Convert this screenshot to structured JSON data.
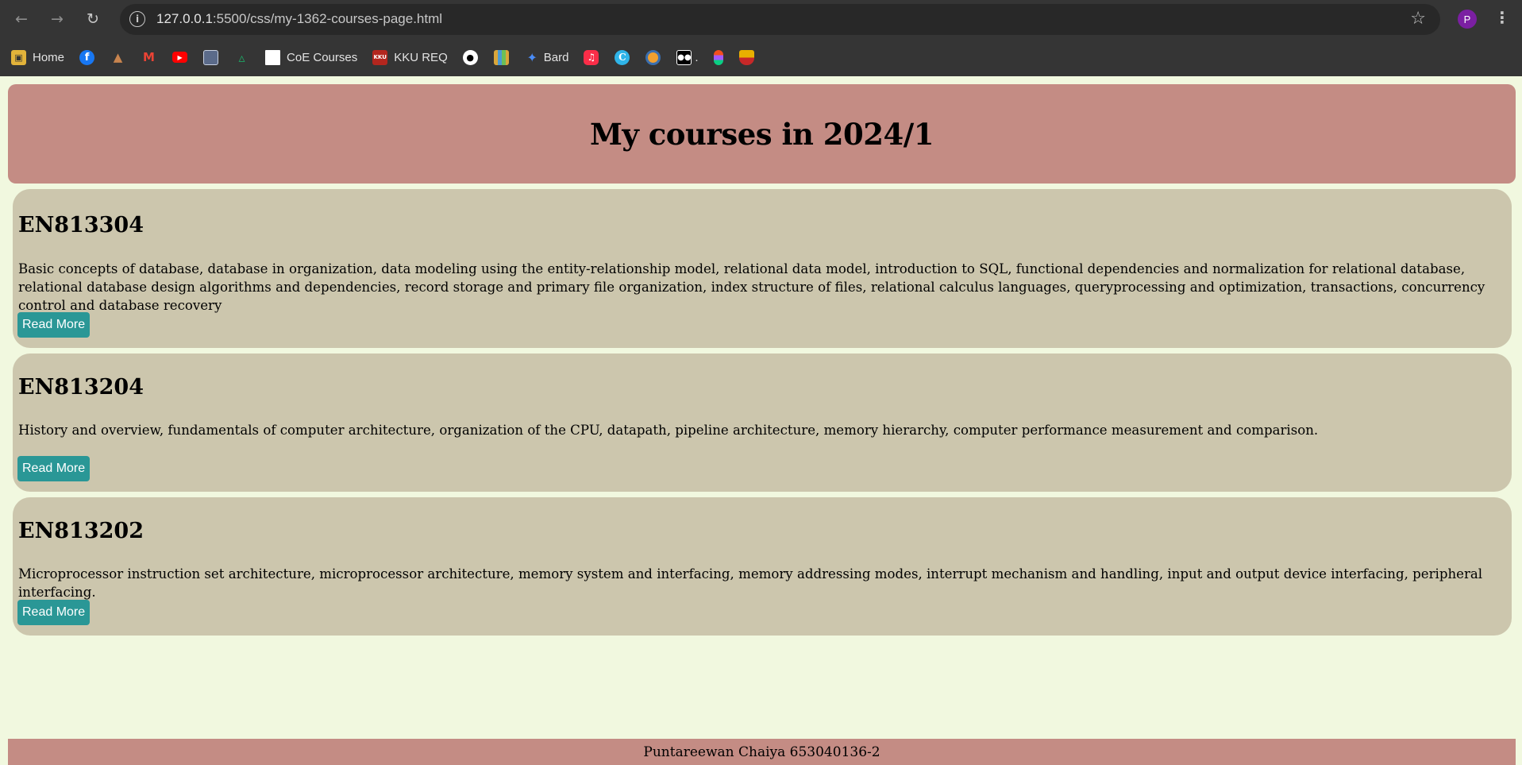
{
  "browser": {
    "url_host": "127.0.0.1",
    "url_path": ":5500/css/my-1362-courses-page.html",
    "profile_initial": "P",
    "bookmarks": [
      {
        "label": "Home",
        "icon": "home-icon",
        "color": "#e2b33a"
      },
      {
        "label": "",
        "icon": "facebook-icon",
        "color": "#1877f2"
      },
      {
        "label": "",
        "icon": "tower-icon",
        "color": "#8a5a44"
      },
      {
        "label": "",
        "icon": "gmail-icon",
        "color": "#ea4335"
      },
      {
        "label": "",
        "icon": "youtube-icon",
        "color": "#ff0000"
      },
      {
        "label": "",
        "icon": "photo-icon",
        "color": "#5b6b8a"
      },
      {
        "label": "",
        "icon": "google-drive-icon",
        "color": "#1fa463"
      },
      {
        "label": "CoE Courses",
        "icon": "page-icon",
        "color": "#ffffff"
      },
      {
        "label": "KKU REQ",
        "icon": "kku-icon",
        "color": "#b3261e"
      },
      {
        "label": "",
        "icon": "github-icon",
        "color": "#ffffff"
      },
      {
        "label": "",
        "icon": "grid-app-icon",
        "color": "#d9a63a"
      },
      {
        "label": "Bard",
        "icon": "bard-sparkle-icon",
        "color": "#4a8cf7"
      },
      {
        "label": "",
        "icon": "music-icon",
        "color": "#fa2d48"
      },
      {
        "label": "",
        "icon": "canva-icon",
        "color": "#2fb4e8"
      },
      {
        "label": "",
        "icon": "circle-app-icon",
        "color": "#f0a030"
      },
      {
        "label": ".",
        "icon": "medium-icon",
        "color": "#000000"
      },
      {
        "label": "",
        "icon": "figma-icon",
        "color": "#f24e1e"
      },
      {
        "label": "",
        "icon": "badge-icon",
        "color": "#e8b000"
      }
    ]
  },
  "header": {
    "title": "My courses in 2024/1"
  },
  "courses": [
    {
      "code": "EN813304",
      "description": "Basic concepts of database, database in organization, data modeling using the entity-relationship model, relational data model, introduction to SQL, functional dependencies and normalization for relational database, relational database design algorithms and dependencies, record storage and primary file organization, index structure of files, relational calculus languages, queryprocessing and optimization, transactions, concurrency control and database recovery",
      "button": "Read More"
    },
    {
      "code": "EN813204",
      "description": "History and overview, fundamentals of computer architecture, organization of the CPU, datapath, pipeline architecture, memory hierarchy, computer performance measurement and comparison.",
      "button": "Read More"
    },
    {
      "code": "EN813202",
      "description": "Microprocessor instruction set architecture, microprocessor architecture, memory system and interfacing, memory addressing modes, interrupt mechanism and handling, input and output device interfacing, peripheral interfacing.",
      "button": "Read More"
    }
  ],
  "footer": {
    "text": "Puntareewan Chaiya 653040136-2"
  },
  "colors": {
    "page_background": "#f1f8df",
    "header_background": "#c48c84",
    "card_background": "#ccc6ad",
    "button_background": "#2a9796"
  }
}
